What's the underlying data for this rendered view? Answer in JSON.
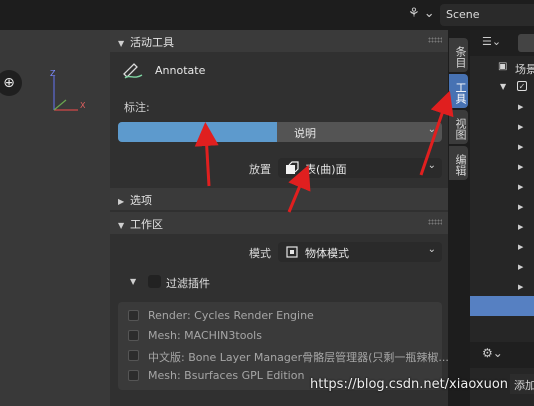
{
  "header": {
    "scene_icon": "scene-icon",
    "scene_name": "Scene"
  },
  "viewport": {
    "zoom_icon": "zoom-icon",
    "gizmo": {
      "z_label": "Z",
      "x_label": "X"
    }
  },
  "npanel": {
    "active_tool": {
      "title": "活动工具",
      "tool_name": "Annotate",
      "note_label": "标注:",
      "note_value": "说明",
      "note_fill_fraction": 0.49,
      "placement_label": "放置",
      "placement_value": "表(曲)面"
    },
    "options": {
      "title": "选项"
    },
    "workspace": {
      "title": "工作区",
      "mode_label": "模式",
      "mode_value": "物体模式",
      "filter_label": "过滤插件",
      "addons": [
        {
          "label": "Render: Cycles Render Engine"
        },
        {
          "label": "Mesh: MACHIN3tools"
        },
        {
          "label": "中文版: Bone Layer Manager骨骼层管理器(只剩一瓶辣椒..."
        },
        {
          "label": "Mesh: Bsurfaces GPL Edition"
        }
      ]
    }
  },
  "tabs": [
    {
      "label": "条目",
      "active": false
    },
    {
      "label": "工具",
      "active": true
    },
    {
      "label": "视图",
      "active": false
    },
    {
      "label": "编辑",
      "active": false
    }
  ],
  "outliner": {
    "collection_label": "场景",
    "add_label": "添加"
  },
  "colors": {
    "accent": "#4772b3",
    "note_fill": "#5d9acd",
    "annotation_arrow": "#e01f1f",
    "selected_row": "#5680c2"
  },
  "watermark": "https://blog.csdn.net/xiaoxuon"
}
